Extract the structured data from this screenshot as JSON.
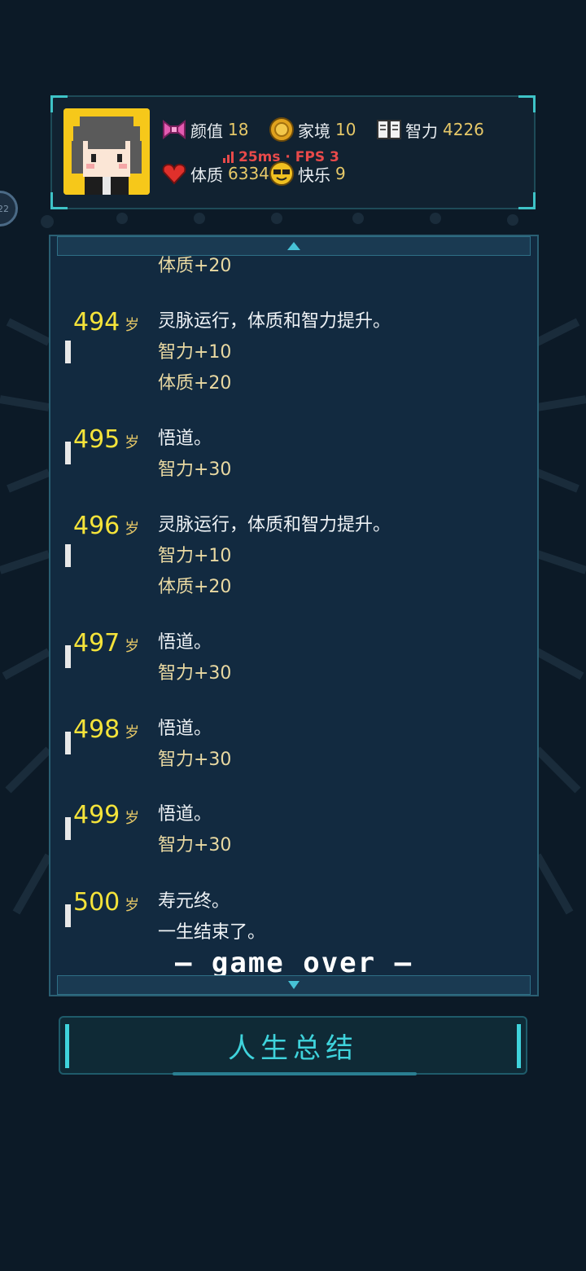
{
  "colors": {
    "background": "#0c1a27",
    "panel": "#122a40",
    "accent": "#3fd3dc",
    "age": "#f4e33a",
    "stat_value": "#e6c868",
    "fps": "#e84a4a"
  },
  "side_bubble": {
    "text": "22"
  },
  "header": {
    "stats": [
      {
        "icon": "bow-icon",
        "label": "颜值",
        "value": "18"
      },
      {
        "icon": "coin-icon",
        "label": "家境",
        "value": "10"
      },
      {
        "icon": "book-icon",
        "label": "智力",
        "value": "4226"
      },
      {
        "icon": "heart-icon",
        "label": "体质",
        "value": "6334"
      },
      {
        "icon": "sunglasses-smiley-icon",
        "label": "快乐",
        "value": "9"
      }
    ],
    "fps_overlay": {
      "text": "25ms · FPS 3"
    }
  },
  "log": {
    "partial_top_line": "体质+20",
    "age_unit": "岁",
    "entries": [
      {
        "age": "494",
        "lines": [
          "灵脉运行，体质和智力提升。",
          "智力+10",
          "体质+20"
        ]
      },
      {
        "age": "495",
        "lines": [
          "悟道。",
          "智力+30"
        ]
      },
      {
        "age": "496",
        "lines": [
          "灵脉运行，体质和智力提升。",
          "智力+10",
          "体质+20"
        ]
      },
      {
        "age": "497",
        "lines": [
          "悟道。",
          "智力+30"
        ]
      },
      {
        "age": "498",
        "lines": [
          "悟道。",
          "智力+30"
        ]
      },
      {
        "age": "499",
        "lines": [
          "悟道。",
          "智力+30"
        ]
      },
      {
        "age": "500",
        "lines": [
          "寿元终。",
          "一生结束了。"
        ]
      }
    ],
    "game_over": "— game over —"
  },
  "summary_button": {
    "label": "人生总结"
  }
}
